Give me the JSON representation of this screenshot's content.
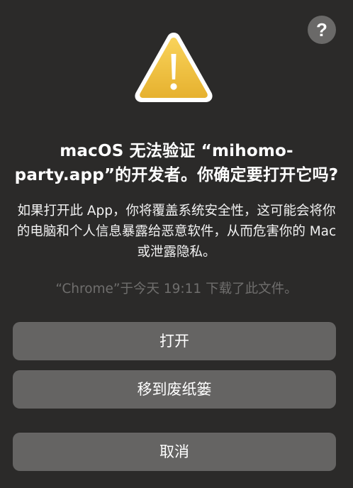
{
  "dialog": {
    "help_label": "?",
    "title": "macOS 无法验证 “mihomo-party.app”的开发者。你确定要打开它吗?",
    "message": "如果打开此 App，你将覆盖系统安全性，这可能会将你的电脑和个人信息暴露给恶意软件，从而危害你的 Mac 或泄露隐私。",
    "download_note": "“Chrome”于今天 19:11 下载了此文件。",
    "buttons": {
      "open": "打开",
      "move_to_trash": "移到废纸篓",
      "cancel": "取消"
    }
  },
  "icons": {
    "warning": "warning-triangle-icon",
    "help": "help-icon"
  },
  "colors": {
    "background": "#2b2a29",
    "button": "#656463",
    "warning_fill": "#f2c443",
    "muted_text": "#6f6e6d"
  }
}
